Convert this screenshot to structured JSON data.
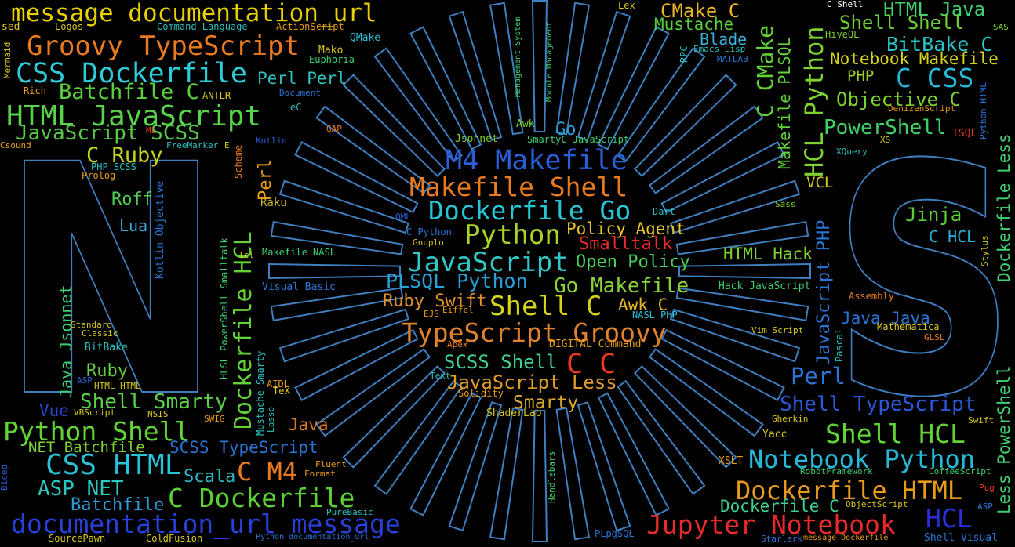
{
  "colors": {
    "background": "#000000",
    "outline": "#3f7fbf"
  },
  "logo_letters": [
    "N",
    "S"
  ],
  "words": [
    {
      "text": "message documentation_url",
      "color": "#e8d000"
    },
    {
      "text": "Groovy TypeScript",
      "color": "#e87a20"
    },
    {
      "text": "CSS Dockerfile",
      "color": "#2ecbd8"
    },
    {
      "text": "Batchfile C",
      "color": "#58d23a"
    },
    {
      "text": "HTML JavaScript",
      "color": "#56d34a"
    },
    {
      "text": "JavaScript SCSS",
      "color": "#59c94a"
    },
    {
      "text": "C Ruby",
      "color": "#c6d21e"
    },
    {
      "text": "Roff",
      "color": "#50cc55"
    },
    {
      "text": "Lua",
      "color": "#3aa8d8"
    },
    {
      "text": "Python Shell",
      "color": "#62d336"
    },
    {
      "text": "CSS HTML",
      "color": "#27c2d6"
    },
    {
      "text": "ASP NET",
      "color": "#2bc8c2"
    },
    {
      "text": "Batchfile",
      "color": "#2d9ed5"
    },
    {
      "text": "documentation_url message",
      "color": "#2740d8"
    },
    {
      "text": "NET Batchfile",
      "color": "#7ed22f"
    },
    {
      "text": "Shell Smarty",
      "color": "#5bd04a"
    },
    {
      "text": "Ruby",
      "color": "#65c945"
    },
    {
      "text": "Vue",
      "color": "#2a45c9"
    },
    {
      "text": "SCSS TypeScript",
      "color": "#2a74d4"
    },
    {
      "text": "Scala",
      "color": "#2eb8c5"
    },
    {
      "text": "C M4",
      "color": "#e87a20"
    },
    {
      "text": "C Dockerfile",
      "color": "#5ad035"
    },
    {
      "text": "Java",
      "color": "#e07a22"
    },
    {
      "text": "M4 Makefile",
      "color": "#2a5ed8"
    },
    {
      "text": "Makefile Shell",
      "color": "#e67b22"
    },
    {
      "text": "Dockerfile Go",
      "color": "#27c4d4"
    },
    {
      "text": "Python",
      "color": "#a8d42a"
    },
    {
      "text": "Policy Agent",
      "color": "#e8c82a"
    },
    {
      "text": "Smalltalk",
      "color": "#e82a2a"
    },
    {
      "text": "JavaScript",
      "color": "#33c6c8"
    },
    {
      "text": "Open Policy",
      "color": "#48d05a"
    },
    {
      "text": "PLSQL Python",
      "color": "#2a9fd5"
    },
    {
      "text": "Go Makefile",
      "color": "#8cd23a"
    },
    {
      "text": "Ruby Swift",
      "color": "#e0902a"
    },
    {
      "text": "Shell C",
      "color": "#d4d21a"
    },
    {
      "text": "Awk C",
      "color": "#e0b42a"
    },
    {
      "text": "TypeScript Groovy",
      "color": "#e0822a"
    },
    {
      "text": "SCSS Shell",
      "color": "#3fd090"
    },
    {
      "text": "C C",
      "color": "#e83a1a"
    },
    {
      "text": "JavaScript Less",
      "color": "#e09a2a"
    },
    {
      "text": "Smarty",
      "color": "#d8a830"
    },
    {
      "text": "Go",
      "color": "#2a9fd5"
    },
    {
      "text": "Perl Perl",
      "color": "#2ec0c0"
    },
    {
      "text": "CMake C",
      "color": "#e8b42a"
    },
    {
      "text": "Mustache",
      "color": "#58cc3a"
    },
    {
      "text": "Blade",
      "color": "#3ab0d8"
    },
    {
      "text": "HTML Java",
      "color": "#3fd070"
    },
    {
      "text": "Shell Shell",
      "color": "#6dd03a"
    },
    {
      "text": "BitBake C",
      "color": "#27c4c8"
    },
    {
      "text": "Notebook Makefile",
      "color": "#d8d21e"
    },
    {
      "text": "PHP",
      "color": "#9cd22a"
    },
    {
      "text": "C CSS",
      "color": "#27b8d8"
    },
    {
      "text": "Objective C",
      "color": "#7ed22f"
    },
    {
      "text": "PowerShell",
      "color": "#40d06a"
    },
    {
      "text": "Jinja",
      "color": "#5ad035"
    },
    {
      "text": "C HCL",
      "color": "#2ab2d8"
    },
    {
      "text": "HTML Hack",
      "color": "#7ed22f"
    },
    {
      "text": "Perl",
      "color": "#2a74d4"
    },
    {
      "text": "Java Java",
      "color": "#2a74d4"
    },
    {
      "text": "Shell TypeScript",
      "color": "#2a58d8"
    },
    {
      "text": "Shell HCL",
      "color": "#62d336"
    },
    {
      "text": "Notebook Python",
      "color": "#27b8d8"
    },
    {
      "text": "Dockerfile HTML",
      "color": "#e89a1a"
    },
    {
      "text": "Dockerfile C",
      "color": "#3fd090"
    },
    {
      "text": "Jupyter Notebook",
      "color": "#e82a2a"
    },
    {
      "text": "HCL",
      "color": "#2a30d8"
    },
    {
      "text": "VCL",
      "color": "#d8c820"
    },
    {
      "text": "Raku",
      "color": "#c8b42a"
    },
    {
      "text": "Perl",
      "color": "#e8a01a"
    },
    {
      "text": "Dockerfile HCL",
      "color": "#62d336"
    },
    {
      "text": "Java Jsonnet",
      "color": "#3fd070"
    },
    {
      "text": "HCL Python",
      "color": "#7ed22f"
    },
    {
      "text": "C CMake",
      "color": "#62d336"
    },
    {
      "text": "Makefile PLSQL",
      "color": "#62d336"
    },
    {
      "text": "JavaScript PHP",
      "color": "#2a74d4"
    },
    {
      "text": "Dockerfile Less",
      "color": "#3fd070"
    },
    {
      "text": "Less PowerShell",
      "color": "#3fd070"
    },
    {
      "text": "Logos",
      "color": "#d8c820"
    },
    {
      "text": "sed",
      "color": "#e8c82a"
    },
    {
      "text": "Command Language",
      "color": "#2ec0c0"
    },
    {
      "text": "ActionScript",
      "color": "#e89a1a"
    },
    {
      "text": "QMake",
      "color": "#2ec0d8"
    },
    {
      "text": "Mako",
      "color": "#d8c820"
    },
    {
      "text": "Euphoria",
      "color": "#3fd070"
    },
    {
      "text": "ANTLR",
      "color": "#d8c820"
    },
    {
      "text": "Rich",
      "color": "#e89a1a"
    },
    {
      "text": "Document",
      "color": "#2a74d4"
    },
    {
      "text": "eC",
      "color": "#2ec0c0"
    },
    {
      "text": "GAP",
      "color": "#e87a20"
    },
    {
      "text": "ML",
      "color": "#e83a1a"
    },
    {
      "text": "Kotlin",
      "color": "#2a5ed8"
    },
    {
      "text": "Csound",
      "color": "#e8a01a"
    },
    {
      "text": "FreeMarker",
      "color": "#2ec0c0"
    },
    {
      "text": "E",
      "color": "#d8c820"
    },
    {
      "text": "PHP SCSS",
      "color": "#2ec0c0"
    },
    {
      "text": "Prolog",
      "color": "#e8a01a"
    },
    {
      "text": "Awk",
      "color": "#7ed22f"
    },
    {
      "text": "Jsonnet",
      "color": "#7ed22f"
    },
    {
      "text": "SmartyC JavaScript",
      "color": "#3fd070"
    },
    {
      "text": "Dart",
      "color": "#2ec0c0"
    },
    {
      "text": "QML",
      "color": "#2a5ed8"
    },
    {
      "text": "C Python",
      "color": "#2a74d4"
    },
    {
      "text": "Gnuplot",
      "color": "#d8c820"
    },
    {
      "text": "Makefile NASL",
      "color": "#3fd070"
    },
    {
      "text": "Tcl",
      "color": "#d8c820"
    },
    {
      "text": "Visual Basic",
      "color": "#2a74d4"
    },
    {
      "text": "Standard",
      "color": "#d8c820"
    },
    {
      "text": "Classic",
      "color": "#d8c820"
    },
    {
      "text": "BitBake",
      "color": "#2ec0c0"
    },
    {
      "text": "ASP",
      "color": "#2a5ed8"
    },
    {
      "text": "HTML HTML",
      "color": "#d8c820"
    },
    {
      "text": "VBScript",
      "color": "#d8c820"
    },
    {
      "text": "NSIS",
      "color": "#d8c820"
    },
    {
      "text": "SWIG",
      "color": "#e89a1a"
    },
    {
      "text": "AIDL",
      "color": "#e89a1a"
    },
    {
      "text": "TeX",
      "color": "#d8c820"
    },
    {
      "text": "Lasso",
      "color": "#2ec0c0"
    },
    {
      "text": "EJS",
      "color": "#e89a1a"
    },
    {
      "text": "Eiffel",
      "color": "#e89a1a"
    },
    {
      "text": "Apex",
      "color": "#e87a20"
    },
    {
      "text": "DIGITAL Command",
      "color": "#e8a01a"
    },
    {
      "text": "Text",
      "color": "#2ec0c0"
    },
    {
      "text": "Solidity",
      "color": "#e89a1a"
    },
    {
      "text": "ShaderLab",
      "color": "#d8c820"
    },
    {
      "text": "Fluent",
      "color": "#e89a1a"
    },
    {
      "text": "Format",
      "color": "#e89a1a"
    },
    {
      "text": "PureBasic",
      "color": "#2ec0c0"
    },
    {
      "text": "SourcePawn",
      "color": "#d8c820"
    },
    {
      "text": "ColdFusion",
      "color": "#d8c820"
    },
    {
      "text": "Python documentation_url",
      "color": "#2a74d4"
    },
    {
      "text": "PLpgSQL",
      "color": "#2a74d4"
    },
    {
      "text": "Starlark",
      "color": "#2a74d4"
    },
    {
      "text": "message Dockerfile",
      "color": "#e89a1a"
    },
    {
      "text": "Shell Visual",
      "color": "#2a74d4"
    },
    {
      "text": "Lex",
      "color": "#d8c820"
    },
    {
      "text": "C Shell",
      "color": "#ffffff"
    },
    {
      "text": "HiveQL",
      "color": "#7ed22f"
    },
    {
      "text": "SAS",
      "color": "#7ed22f"
    },
    {
      "text": "Emacs Lisp",
      "color": "#2ec0c0"
    },
    {
      "text": "MATLAB",
      "color": "#2a74d4"
    },
    {
      "text": "RPC",
      "color": "#2ec0c0"
    },
    {
      "text": "DenizenScript",
      "color": "#e89a1a"
    },
    {
      "text": "XS",
      "color": "#d8c820"
    },
    {
      "text": "TSQL",
      "color": "#e83a1a"
    },
    {
      "text": "XQuery",
      "color": "#2ec0c0"
    },
    {
      "text": "Sass",
      "color": "#7ed22f"
    },
    {
      "text": "Hack JavaScript",
      "color": "#3fd070"
    },
    {
      "text": "NASL PHP",
      "color": "#2ec0d8"
    },
    {
      "text": "Assembly",
      "color": "#e87a20"
    },
    {
      "text": "Mathematica",
      "color": "#d8c820"
    },
    {
      "text": "GLSL",
      "color": "#e87a20"
    },
    {
      "text": "Vim Script",
      "color": "#d8c820"
    },
    {
      "text": "Gherkin",
      "color": "#d8c820"
    },
    {
      "text": "Swift",
      "color": "#d8c820"
    },
    {
      "text": "Yacc",
      "color": "#d8c820"
    },
    {
      "text": "XSLT",
      "color": "#e89a1a"
    },
    {
      "text": "RobotFramework",
      "color": "#3fd070"
    },
    {
      "text": "CoffeeScript",
      "color": "#3fd070"
    },
    {
      "text": "ObjectScript",
      "color": "#d8c820"
    },
    {
      "text": "Pug",
      "color": "#e83a1a"
    },
    {
      "text": "ASP",
      "color": "#2a74d4"
    },
    {
      "text": "Bicep",
      "color": "#2a5ed8"
    },
    {
      "text": "Mermaid",
      "color": "#d8c820"
    },
    {
      "text": "Kotlin Objective",
      "color": "#2a74d4"
    },
    {
      "text": "HLSL PowerShell Smalltalk",
      "color": "#3fd070"
    },
    {
      "text": "Mustache Smarty",
      "color": "#2ec0c0"
    },
    {
      "text": "Scheme",
      "color": "#e87a20"
    },
    {
      "text": "Management System",
      "color": "#3fd070"
    },
    {
      "text": "Module Management",
      "color": "#3fd070"
    },
    {
      "text": "Pascal",
      "color": "#2ec0c0"
    },
    {
      "text": "Stylus",
      "color": "#d8c820"
    },
    {
      "text": "Python HTML",
      "color": "#2a74d4"
    },
    {
      "text": "Handlebars",
      "color": "#3fd070"
    }
  ]
}
